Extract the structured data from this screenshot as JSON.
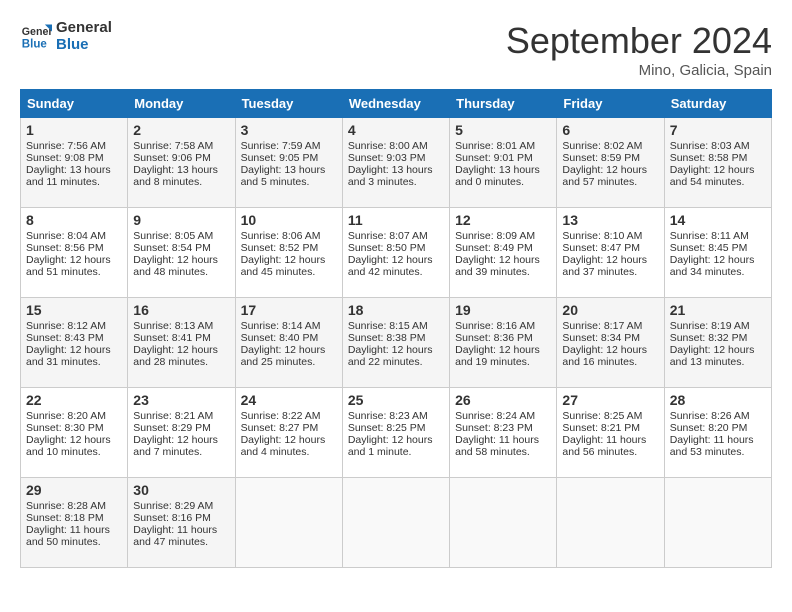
{
  "header": {
    "logo_line1": "General",
    "logo_line2": "Blue",
    "month_title": "September 2024",
    "location": "Mino, Galicia, Spain"
  },
  "weekdays": [
    "Sunday",
    "Monday",
    "Tuesday",
    "Wednesday",
    "Thursday",
    "Friday",
    "Saturday"
  ],
  "weeks": [
    [
      {
        "day": "1",
        "lines": [
          "Sunrise: 7:56 AM",
          "Sunset: 9:08 PM",
          "Daylight: 13 hours",
          "and 11 minutes."
        ]
      },
      {
        "day": "2",
        "lines": [
          "Sunrise: 7:58 AM",
          "Sunset: 9:06 PM",
          "Daylight: 13 hours",
          "and 8 minutes."
        ]
      },
      {
        "day": "3",
        "lines": [
          "Sunrise: 7:59 AM",
          "Sunset: 9:05 PM",
          "Daylight: 13 hours",
          "and 5 minutes."
        ]
      },
      {
        "day": "4",
        "lines": [
          "Sunrise: 8:00 AM",
          "Sunset: 9:03 PM",
          "Daylight: 13 hours",
          "and 3 minutes."
        ]
      },
      {
        "day": "5",
        "lines": [
          "Sunrise: 8:01 AM",
          "Sunset: 9:01 PM",
          "Daylight: 13 hours",
          "and 0 minutes."
        ]
      },
      {
        "day": "6",
        "lines": [
          "Sunrise: 8:02 AM",
          "Sunset: 8:59 PM",
          "Daylight: 12 hours",
          "and 57 minutes."
        ]
      },
      {
        "day": "7",
        "lines": [
          "Sunrise: 8:03 AM",
          "Sunset: 8:58 PM",
          "Daylight: 12 hours",
          "and 54 minutes."
        ]
      }
    ],
    [
      {
        "day": "8",
        "lines": [
          "Sunrise: 8:04 AM",
          "Sunset: 8:56 PM",
          "Daylight: 12 hours",
          "and 51 minutes."
        ]
      },
      {
        "day": "9",
        "lines": [
          "Sunrise: 8:05 AM",
          "Sunset: 8:54 PM",
          "Daylight: 12 hours",
          "and 48 minutes."
        ]
      },
      {
        "day": "10",
        "lines": [
          "Sunrise: 8:06 AM",
          "Sunset: 8:52 PM",
          "Daylight: 12 hours",
          "and 45 minutes."
        ]
      },
      {
        "day": "11",
        "lines": [
          "Sunrise: 8:07 AM",
          "Sunset: 8:50 PM",
          "Daylight: 12 hours",
          "and 42 minutes."
        ]
      },
      {
        "day": "12",
        "lines": [
          "Sunrise: 8:09 AM",
          "Sunset: 8:49 PM",
          "Daylight: 12 hours",
          "and 39 minutes."
        ]
      },
      {
        "day": "13",
        "lines": [
          "Sunrise: 8:10 AM",
          "Sunset: 8:47 PM",
          "Daylight: 12 hours",
          "and 37 minutes."
        ]
      },
      {
        "day": "14",
        "lines": [
          "Sunrise: 8:11 AM",
          "Sunset: 8:45 PM",
          "Daylight: 12 hours",
          "and 34 minutes."
        ]
      }
    ],
    [
      {
        "day": "15",
        "lines": [
          "Sunrise: 8:12 AM",
          "Sunset: 8:43 PM",
          "Daylight: 12 hours",
          "and 31 minutes."
        ]
      },
      {
        "day": "16",
        "lines": [
          "Sunrise: 8:13 AM",
          "Sunset: 8:41 PM",
          "Daylight: 12 hours",
          "and 28 minutes."
        ]
      },
      {
        "day": "17",
        "lines": [
          "Sunrise: 8:14 AM",
          "Sunset: 8:40 PM",
          "Daylight: 12 hours",
          "and 25 minutes."
        ]
      },
      {
        "day": "18",
        "lines": [
          "Sunrise: 8:15 AM",
          "Sunset: 8:38 PM",
          "Daylight: 12 hours",
          "and 22 minutes."
        ]
      },
      {
        "day": "19",
        "lines": [
          "Sunrise: 8:16 AM",
          "Sunset: 8:36 PM",
          "Daylight: 12 hours",
          "and 19 minutes."
        ]
      },
      {
        "day": "20",
        "lines": [
          "Sunrise: 8:17 AM",
          "Sunset: 8:34 PM",
          "Daylight: 12 hours",
          "and 16 minutes."
        ]
      },
      {
        "day": "21",
        "lines": [
          "Sunrise: 8:19 AM",
          "Sunset: 8:32 PM",
          "Daylight: 12 hours",
          "and 13 minutes."
        ]
      }
    ],
    [
      {
        "day": "22",
        "lines": [
          "Sunrise: 8:20 AM",
          "Sunset: 8:30 PM",
          "Daylight: 12 hours",
          "and 10 minutes."
        ]
      },
      {
        "day": "23",
        "lines": [
          "Sunrise: 8:21 AM",
          "Sunset: 8:29 PM",
          "Daylight: 12 hours",
          "and 7 minutes."
        ]
      },
      {
        "day": "24",
        "lines": [
          "Sunrise: 8:22 AM",
          "Sunset: 8:27 PM",
          "Daylight: 12 hours",
          "and 4 minutes."
        ]
      },
      {
        "day": "25",
        "lines": [
          "Sunrise: 8:23 AM",
          "Sunset: 8:25 PM",
          "Daylight: 12 hours",
          "and 1 minute."
        ]
      },
      {
        "day": "26",
        "lines": [
          "Sunrise: 8:24 AM",
          "Sunset: 8:23 PM",
          "Daylight: 11 hours",
          "and 58 minutes."
        ]
      },
      {
        "day": "27",
        "lines": [
          "Sunrise: 8:25 AM",
          "Sunset: 8:21 PM",
          "Daylight: 11 hours",
          "and 56 minutes."
        ]
      },
      {
        "day": "28",
        "lines": [
          "Sunrise: 8:26 AM",
          "Sunset: 8:20 PM",
          "Daylight: 11 hours",
          "and 53 minutes."
        ]
      }
    ],
    [
      {
        "day": "29",
        "lines": [
          "Sunrise: 8:28 AM",
          "Sunset: 8:18 PM",
          "Daylight: 11 hours",
          "and 50 minutes."
        ]
      },
      {
        "day": "30",
        "lines": [
          "Sunrise: 8:29 AM",
          "Sunset: 8:16 PM",
          "Daylight: 11 hours",
          "and 47 minutes."
        ]
      },
      {
        "day": "",
        "lines": []
      },
      {
        "day": "",
        "lines": []
      },
      {
        "day": "",
        "lines": []
      },
      {
        "day": "",
        "lines": []
      },
      {
        "day": "",
        "lines": []
      }
    ]
  ]
}
